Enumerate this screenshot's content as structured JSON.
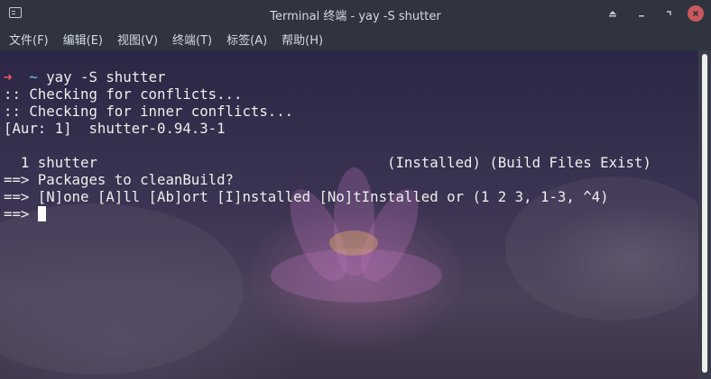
{
  "window": {
    "title": "Terminal 终端 - yay -S shutter",
    "icons": {
      "app": "terminal-icon",
      "shade": "shade-icon",
      "minimize": "minimize-icon",
      "maximize": "maximize-icon",
      "close": "close-icon"
    }
  },
  "menubar": {
    "items": [
      "文件(F)",
      "编辑(E)",
      "视图(V)",
      "终端(T)",
      "标签(A)",
      "帮助(H)"
    ]
  },
  "terminal": {
    "prompt_arrow": "➜",
    "prompt_dir": "~",
    "command": " yay -S shutter",
    "lines": [
      ":: Checking for conflicts...",
      ":: Checking for inner conflicts...",
      "[Aur: 1]  shutter-0.94.3-1",
      "",
      "  1 shutter                                  (Installed) (Build Files Exist)",
      "==> Packages to cleanBuild?",
      "==> [N]one [A]ll [Ab]ort [I]nstalled [No]tInstalled or (1 2 3, 1-3, ^4)"
    ],
    "input_prompt": "==> "
  },
  "colors": {
    "titlebar_bg": "#2f343f",
    "title_text": "#d3dae3",
    "close_button": "#cc575d",
    "prompt_arrow": "#ef5a5a",
    "prompt_dir": "#6fc6e8",
    "terminal_text": "#eeeeec"
  }
}
